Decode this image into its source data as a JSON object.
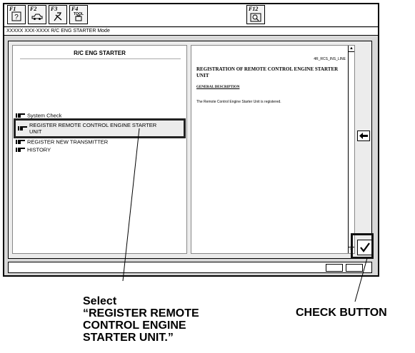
{
  "toolbar": {
    "keys": [
      {
        "label": "F1",
        "icon": "help-icon"
      },
      {
        "label": "F2",
        "icon": "vehicle-icon"
      },
      {
        "label": "F3",
        "icon": "tools-icon"
      },
      {
        "label": "F4",
        "icon": "tool-box-icon",
        "icon_text": "TOOL"
      },
      {
        "label": "F12",
        "icon": "search-icon"
      }
    ]
  },
  "mode_title": "XXXXX XXX-XXXX R/C ENG STARTER Mode",
  "left_pane": {
    "title": "R/C ENG STARTER",
    "items": [
      {
        "label": "System Check"
      },
      {
        "label": "REGISTER REMOTE CONTROL ENGINE STARTER UNIT",
        "selected": true
      },
      {
        "label": "REGISTER NEW TRANSMITTER"
      },
      {
        "label": "HISTORY"
      }
    ]
  },
  "right_pane": {
    "doc_id": "4R_RCS_INS_LINE",
    "title": "REGISTRATION OF REMOTE CONTROL ENGINE STARTER UNIT",
    "subheading": "GENERAL DESCRIPTION",
    "body": "The Remote Control Engine Starter Unit is registered."
  },
  "annotations": {
    "select_label": "Select\n“REGISTER REMOTE\nCONTROL ENGINE\nSTARTER UNIT.”",
    "check_label": "CHECK BUTTON"
  }
}
